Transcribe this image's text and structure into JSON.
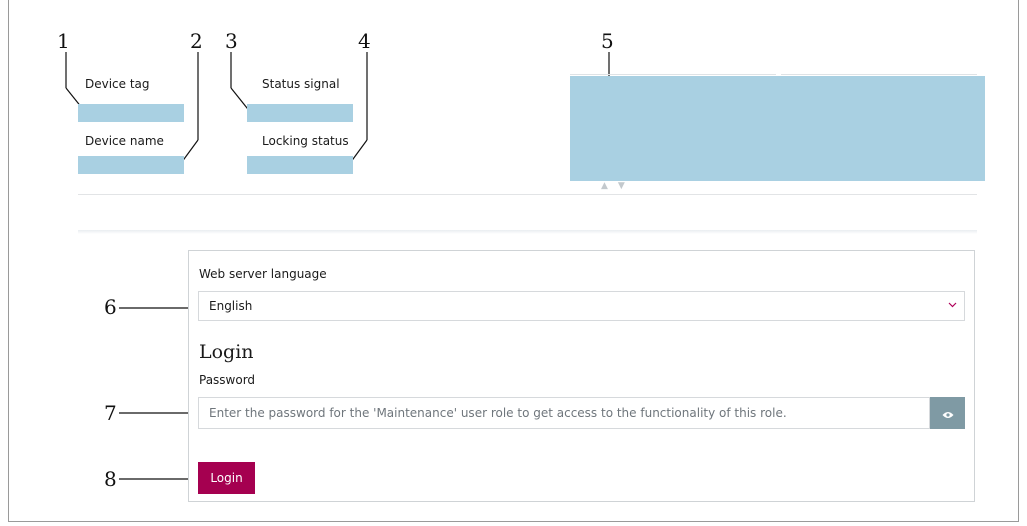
{
  "callouts": {
    "c1": "1",
    "c2": "2",
    "c3": "3",
    "c4": "4",
    "c5": "5",
    "c6": "6",
    "c7": "7",
    "c8": "8"
  },
  "header": {
    "device_tag_label": "Device tag",
    "device_name_label": "Device name",
    "status_signal_label": "Status signal",
    "locking_status_label": "Locking status"
  },
  "language": {
    "label": "Web server language",
    "selected": "English"
  },
  "login": {
    "title": "Login",
    "password_label": "Password",
    "password_placeholder": "Enter the password for the 'Maintenance' user role to get access to the functionality of this role.",
    "button_label": "Login"
  },
  "colors": {
    "highlight": "#a9d0e2",
    "accent": "#a50050",
    "eye_button": "#7f9aa4"
  },
  "icons": {
    "chevron": "chevron-down-icon",
    "eye": "eye-icon",
    "scroll_arrows": "up-down-arrows-icon"
  }
}
